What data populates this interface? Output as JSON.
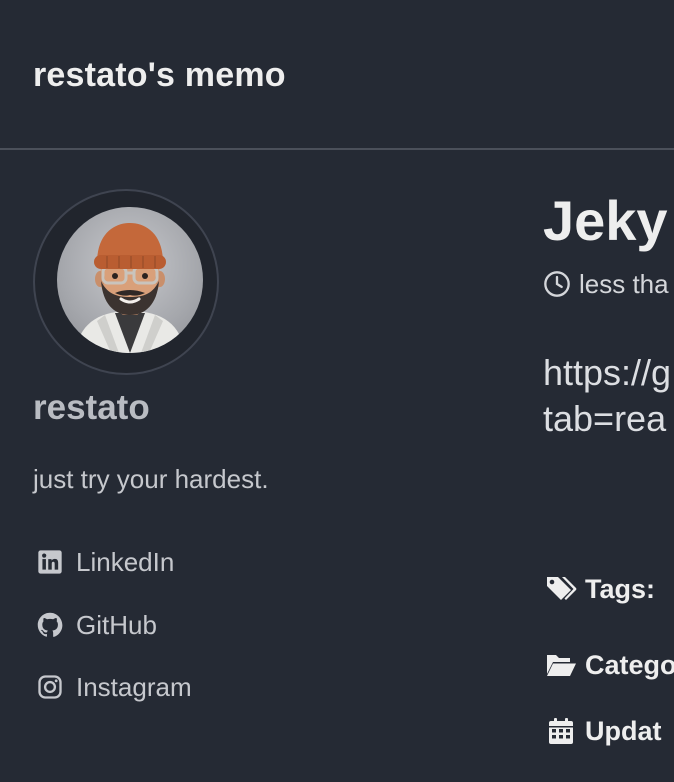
{
  "masthead": {
    "site_title": "restato's memo"
  },
  "author": {
    "name": "restato",
    "bio": "just try your hardest.",
    "links": [
      {
        "label": "LinkedIn",
        "icon": "linkedin-icon"
      },
      {
        "label": "GitHub",
        "icon": "github-icon"
      },
      {
        "label": "Instagram",
        "icon": "instagram-icon"
      }
    ]
  },
  "post": {
    "title": "Jeky",
    "read_time": "less tha",
    "body_lines": [
      "https://g",
      "tab=rea"
    ],
    "meta": {
      "tags_label": "Tags:",
      "categories_label": "Catego",
      "updated_label": "Updat"
    }
  },
  "colors": {
    "background": "#252a34",
    "divider": "#4b505a",
    "text_primary": "#eeeeee",
    "text_secondary": "#c6c8cd"
  }
}
